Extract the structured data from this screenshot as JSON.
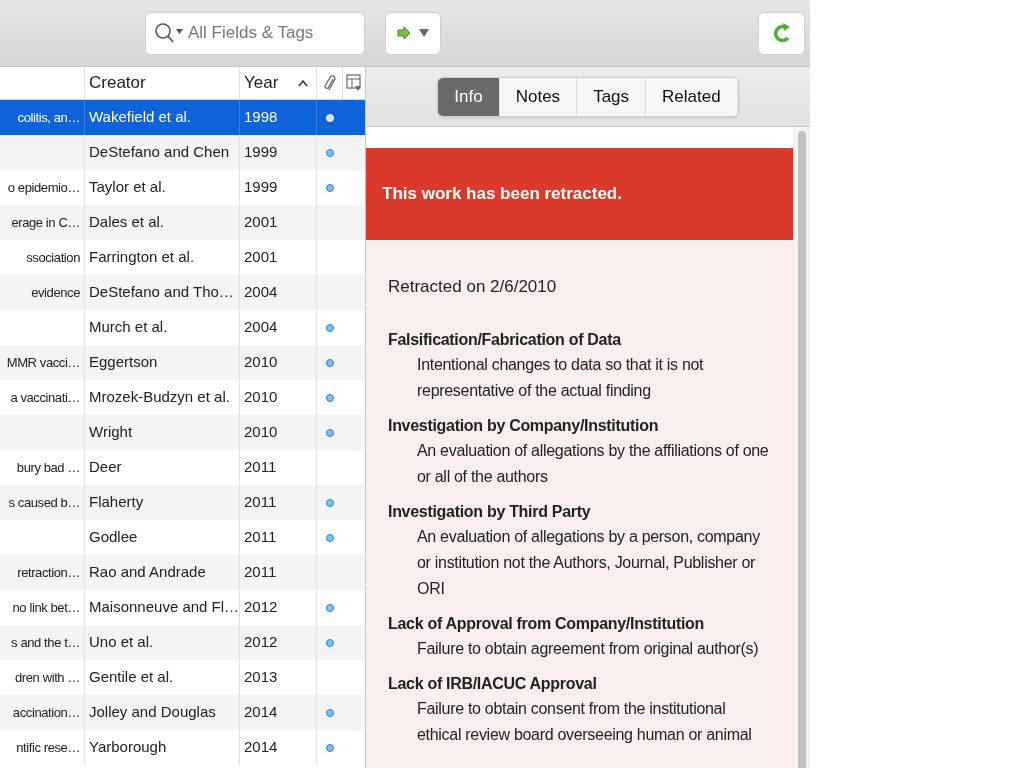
{
  "toolbar": {
    "search": {
      "placeholder": "All Fields & Tags"
    }
  },
  "table": {
    "columns": [
      {
        "label": "Creator",
        "sorted": false
      },
      {
        "label": "Year",
        "sorted": true
      }
    ],
    "rows": [
      {
        "title": "colitis, an…",
        "creator": "Wakefield et al.",
        "year": "1998",
        "attachment": true,
        "selected": true
      },
      {
        "creator": "DeStefano and Chen",
        "year": "1999",
        "attachment": true,
        "selected": false
      },
      {
        "title": "o epidemio…",
        "creator": "Taylor et al.",
        "year": "1999",
        "attachment": true,
        "selected": false
      },
      {
        "title": "erage in C…",
        "creator": "Dales et al.",
        "year": "2001",
        "attachment": false,
        "selected": false
      },
      {
        "title": "ssociation",
        "creator": "Farrington et al.",
        "year": "2001",
        "attachment": false,
        "selected": false
      },
      {
        "title": "evidence",
        "creator": "DeStefano and Tho…",
        "year": "2004",
        "attachment": false,
        "selected": false
      },
      {
        "creator": "Murch et al.",
        "year": "2004",
        "attachment": true,
        "selected": false
      },
      {
        "title": "MMR vacci…",
        "creator": "Eggertson",
        "year": "2010",
        "attachment": true,
        "selected": false
      },
      {
        "title": "a vaccinati…",
        "creator": "Mrozek-Budzyn et al.",
        "year": "2010",
        "attachment": true,
        "selected": false
      },
      {
        "creator": "Wright",
        "year": "2010",
        "attachment": true,
        "selected": false
      },
      {
        "title": "bury bad …",
        "creator": "Deer",
        "year": "2011",
        "attachment": false,
        "selected": false
      },
      {
        "title": "s caused b…",
        "creator": "Flaherty",
        "year": "2011",
        "attachment": true,
        "selected": false
      },
      {
        "creator": "Godlee",
        "year": "2011",
        "attachment": true,
        "selected": false
      },
      {
        "title": "retraction…",
        "creator": "Rao and Andrade",
        "year": "2011",
        "attachment": false,
        "selected": false
      },
      {
        "title": "no link bet…",
        "creator": "Maisonneuve and Fl…",
        "year": "2012",
        "attachment": true,
        "selected": false
      },
      {
        "title": "s and the t…",
        "creator": "Uno et al.",
        "year": "2012",
        "attachment": true,
        "selected": false
      },
      {
        "title": "dren with …",
        "creator": "Gentile et al.",
        "year": "2013",
        "attachment": false,
        "selected": false
      },
      {
        "title": "accination…",
        "creator": "Jolley and Douglas",
        "year": "2014",
        "attachment": true,
        "selected": false
      },
      {
        "title": "ntific rese…",
        "creator": "Yarborough",
        "year": "2014",
        "attachment": true,
        "selected": false
      }
    ]
  },
  "tabs": [
    {
      "label": "Info",
      "selected": true
    },
    {
      "label": "Notes",
      "selected": false
    },
    {
      "label": "Tags",
      "selected": false
    },
    {
      "label": "Related",
      "selected": false
    }
  ],
  "retraction": {
    "banner": "This work has been retracted.",
    "date": "Retracted on 2/6/2010",
    "reasons": [
      {
        "name": "Falsification/Fabrication of Data",
        "description": "Intentional changes to data so that it is not representative of the actual finding"
      },
      {
        "name": "Investigation by Company/Institution",
        "description": "An evaluation of allegations by the affiliations of one or all of the authors"
      },
      {
        "name": "Investigation by Third Party",
        "description": "An evaluation of allegations by a person, company or institution not the Authors, Journal, Publisher or ORI"
      },
      {
        "name": "Lack of Approval from Company/Institution",
        "description": "Failure to obtain agreement from original author(s)"
      },
      {
        "name": "Lack of IRB/IACUC Approval",
        "description": "Failure to obtain consent from the institutional ethical review board overseeing human or animal"
      }
    ]
  }
}
